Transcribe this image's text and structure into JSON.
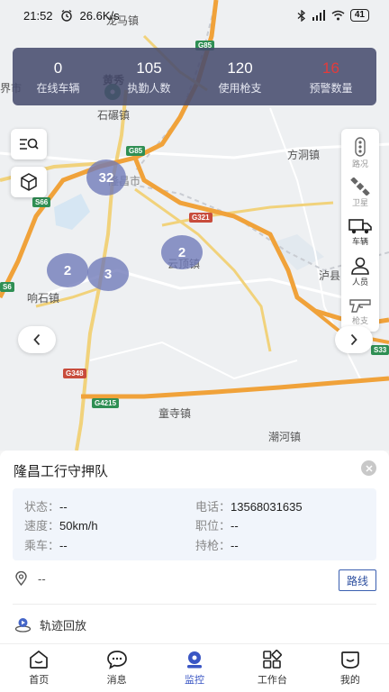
{
  "status_bar": {
    "time": "21:52",
    "speed": "26.6K/s",
    "battery": "41"
  },
  "stats": [
    {
      "value": "0",
      "label": "在线车辆"
    },
    {
      "value": "105",
      "label": "执勤人数"
    },
    {
      "value": "120",
      "label": "使用枪支"
    },
    {
      "value": "16",
      "label": "预警数量",
      "color": "#e43b3b"
    }
  ],
  "map": {
    "places": [
      "龙马镇",
      "界市",
      "黄秀",
      "石碾镇",
      "方洞镇",
      "隆昌市",
      "云顶镇",
      "响石镇",
      "泸县",
      "童寺镇",
      "潮河镇"
    ],
    "road_badges": [
      "G85",
      "G85",
      "S66",
      "G321",
      "S6",
      "G348",
      "G4215",
      "S33"
    ],
    "clusters": [
      "32",
      "2",
      "2",
      "3"
    ]
  },
  "right_tools": [
    {
      "label": "路况",
      "icon": "traffic-light-icon"
    },
    {
      "label": "卫星",
      "icon": "satellite-icon"
    },
    {
      "label": "车辆",
      "icon": "truck-icon"
    },
    {
      "label": "人员",
      "icon": "person-icon"
    },
    {
      "label": "枪支",
      "icon": "gun-icon"
    }
  ],
  "detail": {
    "title": "隆昌工行守押队",
    "status_label": "状态：",
    "status_value": "--",
    "phone_label": "电话：",
    "phone_value": "13568031635",
    "speed_label": "速度：",
    "speed_value": "50km/h",
    "post_label": "职位：",
    "post_value": "--",
    "vehicle_label": "乘车：",
    "vehicle_value": "--",
    "gun_label": "持枪：",
    "gun_value": "--",
    "address": "--",
    "route_button": "路线",
    "track_replay": "轨迹回放"
  },
  "tabs": [
    {
      "label": "首页",
      "icon": "home-icon"
    },
    {
      "label": "消息",
      "icon": "message-icon"
    },
    {
      "label": "监控",
      "icon": "monitor-icon",
      "active": true
    },
    {
      "label": "工作台",
      "icon": "workbench-icon"
    },
    {
      "label": "我的",
      "icon": "profile-icon"
    }
  ],
  "colors": {
    "accent": "#3a56c4",
    "stats_bg": "#484c6e",
    "cluster": "#6e78b9",
    "warning": "#e43b3b"
  }
}
